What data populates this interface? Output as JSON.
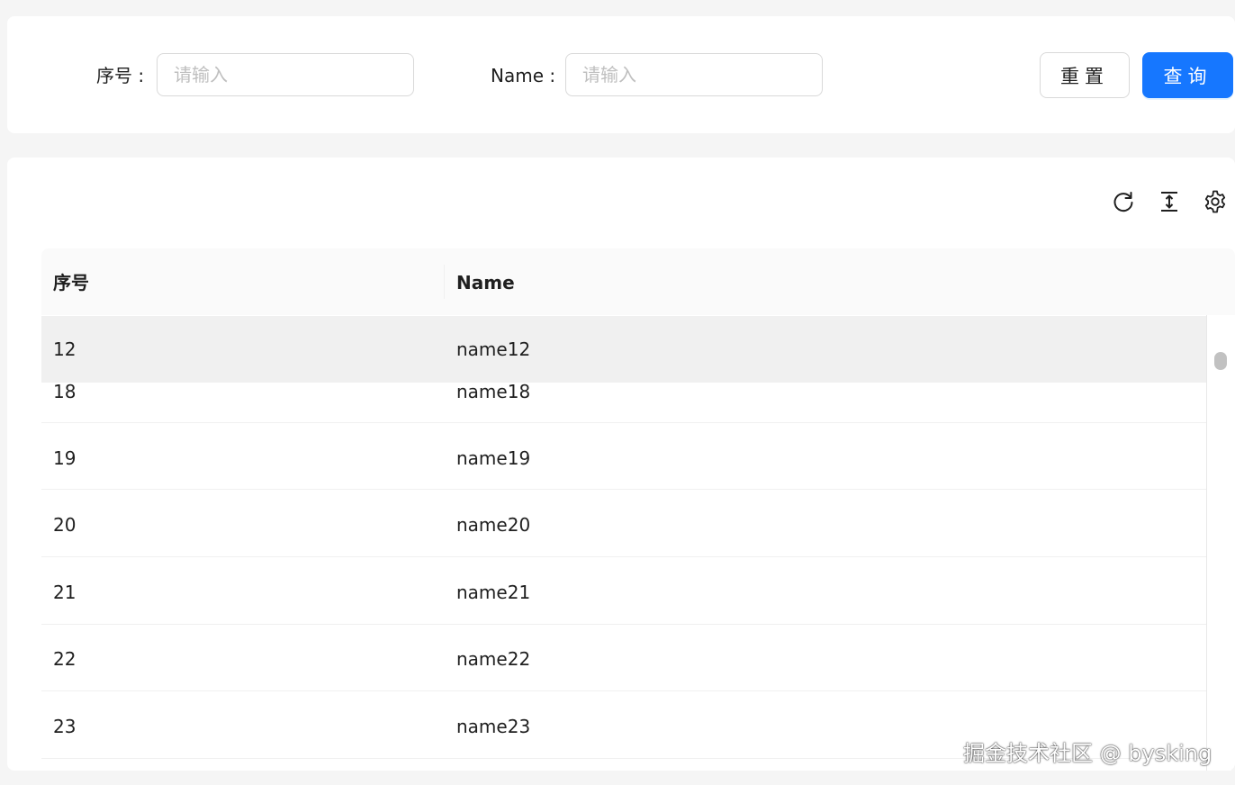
{
  "search_form": {
    "id_label": "序号 :",
    "id_placeholder": "请输入",
    "name_label": "Name :",
    "name_placeholder": "请输入",
    "reset_label": "重置",
    "query_label": "查询"
  },
  "toolbar": {
    "icons": [
      "reload-icon",
      "column-height-icon",
      "setting-icon"
    ]
  },
  "table": {
    "columns": [
      "序号",
      "Name"
    ],
    "sticky_row": {
      "id": "12",
      "name": "name12"
    },
    "rows": [
      {
        "id": "18",
        "name": "name18"
      },
      {
        "id": "19",
        "name": "name19"
      },
      {
        "id": "20",
        "name": "name20"
      },
      {
        "id": "21",
        "name": "name21"
      },
      {
        "id": "22",
        "name": "name22"
      },
      {
        "id": "23",
        "name": "name23"
      }
    ]
  },
  "watermark": "掘金技术社区 @ bysking",
  "colors": {
    "primary": "#1677ff",
    "header_bg": "#fafafa",
    "sticky_row_bg": "#f0f0f0",
    "border": "#d9d9d9"
  }
}
